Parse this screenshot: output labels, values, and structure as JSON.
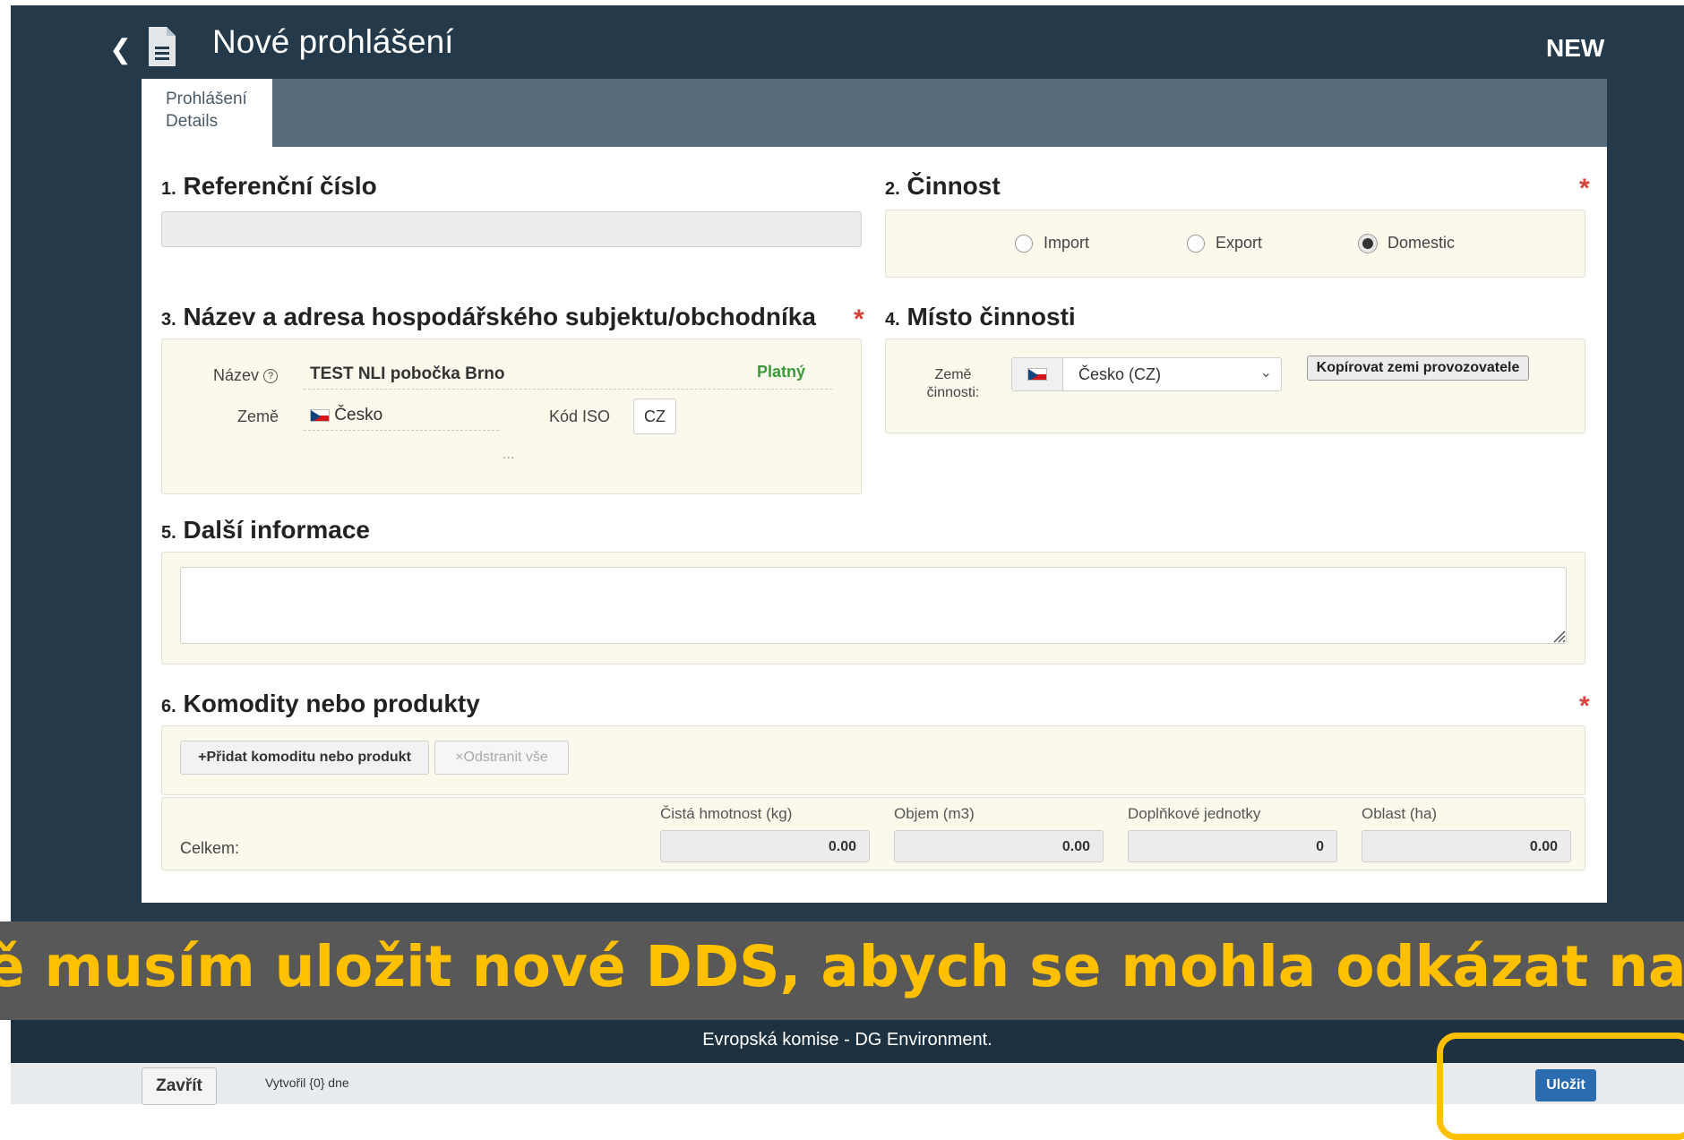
{
  "header": {
    "title": "Nové prohlášení",
    "badge": "NEW"
  },
  "tabs": [
    {
      "line1": "Prohlášení",
      "line2": "Details"
    }
  ],
  "sections": {
    "s1": {
      "num": "1.",
      "title": "Referenční číslo",
      "value": ""
    },
    "s2": {
      "num": "2.",
      "title": "Činnost",
      "required": "*",
      "options": [
        "Import",
        "Export",
        "Domestic"
      ],
      "selected": "Domestic"
    },
    "s3": {
      "num": "3.",
      "title": "Název a adresa hospodářského subjektu/obchodníka",
      "required": "*",
      "name_label": "Název",
      "name_value": "TEST NLI pobočka Brno",
      "status": "Platný",
      "country_label": "Země",
      "country_value": "Česko",
      "iso_label": "Kód ISO",
      "iso_value": "CZ",
      "more": "..."
    },
    "s4": {
      "num": "4.",
      "title": "Místo činnosti",
      "country_label_1": "Země",
      "country_label_2": "činnosti:",
      "select_value": "Česko (CZ)",
      "copy_button": "Kopírovat zemi provozovatele"
    },
    "s5": {
      "num": "5.",
      "title": "Další informace",
      "value": ""
    },
    "s6": {
      "num": "6.",
      "title": "Komodity nebo produkty",
      "required": "*",
      "add_button": "+Přidat komoditu nebo produkt",
      "remove_button": "×Odstranit vše",
      "total_label": "Celkem:",
      "columns": [
        "Čistá hmotnost (kg)",
        "Objem (m3)",
        "Doplňkové jednotky",
        "Oblast (ha)"
      ],
      "totals": [
        "0.00",
        "0.00",
        "0",
        "0.00"
      ]
    }
  },
  "overlay_caption": "ně musím uložit nové DDS, abych se mohla odkázat na stávají",
  "footer": {
    "org": "Evropská komise - DG Environment.",
    "close_button": "Zavřít",
    "created": "Vytvořil {0} dne",
    "save_button": "Uložit"
  },
  "colors": {
    "accent": "#ffc000",
    "save": "#2b6cb0",
    "header": "#243a4b"
  }
}
